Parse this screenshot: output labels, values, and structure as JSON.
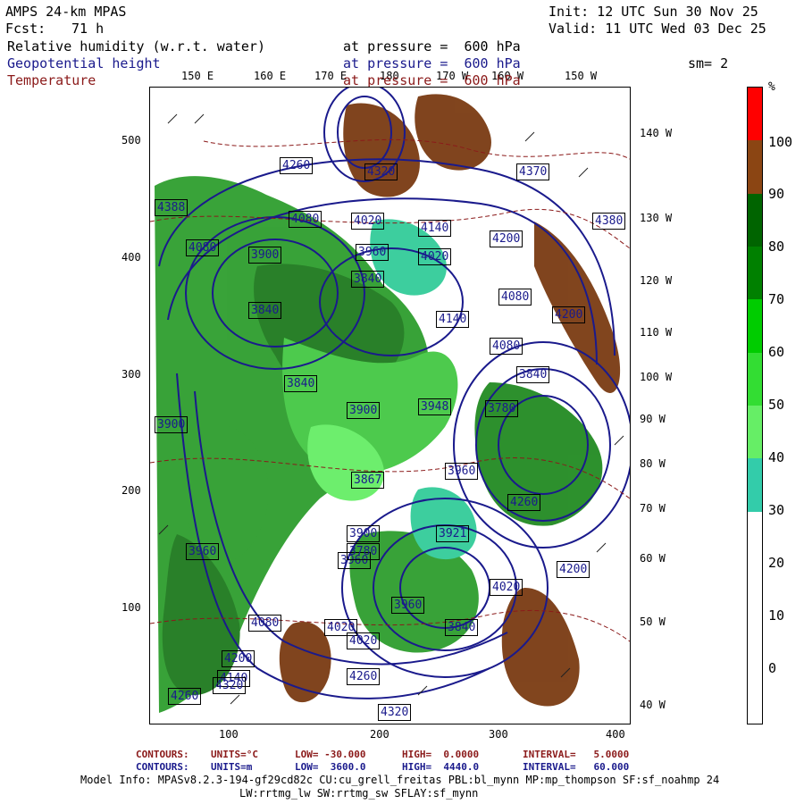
{
  "header": {
    "model": "AMPS 24-km MPAS",
    "init": "Init: 12 UTC Sun 30 Nov 25",
    "fcst_label": "Fcst:",
    "fcst_value": "71 h",
    "valid": "Valid: 11 UTC Wed 03 Dec 25",
    "fields": [
      {
        "name": "Relative humidity (w.r.t. water)",
        "level": "at pressure =  600 hPa",
        "color": "#000000"
      },
      {
        "name": "Geopotential height",
        "level": "at pressure =  600 hPa",
        "color": "#1a1a8c"
      },
      {
        "name": "Temperature",
        "level": "at pressure =  600 hPa",
        "color": "#8b1a1a"
      }
    ],
    "smoothing": "sm= 2"
  },
  "axes": {
    "y_ticks": [
      "500",
      "400",
      "300",
      "200",
      "100"
    ],
    "x_ticks": [
      "100",
      "200",
      "300",
      "400"
    ],
    "top_lon": [
      "150 E",
      "160 E",
      "170 E",
      "180",
      "170 W",
      "160 W",
      "150 W"
    ],
    "right_lon": [
      "140 W",
      "130 W",
      "120 W",
      "110 W",
      "100 W",
      "90 W",
      "80 W",
      "70 W",
      "60 W",
      "50 W",
      "40 W"
    ]
  },
  "height_labels": [
    "4260",
    "4320",
    "4370",
    "4380",
    "4080",
    "4020",
    "3900",
    "4140",
    "4200",
    "4388",
    "4080",
    "3960",
    "4020",
    "4080",
    "3840",
    "3840",
    "4140",
    "4200",
    "4080",
    "3900",
    "3840",
    "3948",
    "3780",
    "3840",
    "4260",
    "3960",
    "3900",
    "3867",
    "3921",
    "3900",
    "3960",
    "4020",
    "4200",
    "3960",
    "3840",
    "4020",
    "4080",
    "4140",
    "4200",
    "4260",
    "4020",
    "4260",
    "4320",
    "4320",
    "3960",
    "3780"
  ],
  "colorbar": {
    "unit": "%",
    "labels": [
      "100",
      "90",
      "80",
      "70",
      "60",
      "50",
      "40",
      "30",
      "20",
      "10",
      "0"
    ],
    "segments": [
      {
        "color": "#ff0000"
      },
      {
        "color": "#8b4513"
      },
      {
        "color": "#006400"
      },
      {
        "color": "#008000"
      },
      {
        "color": "#00cc00"
      },
      {
        "color": "#33dd33"
      },
      {
        "color": "#66ee66"
      },
      {
        "color": "#33ccaa"
      },
      {
        "color": "#ffffff"
      },
      {
        "color": "#ffffff"
      },
      {
        "color": "#ffffff"
      },
      {
        "color": "#ffffff"
      }
    ]
  },
  "footer": {
    "temp_contours": {
      "label": "CONTOURS:",
      "units": "UNITS=°C",
      "low": "LOW= -30.000",
      "high": "HIGH=  0.0000",
      "interval": "INTERVAL=   5.0000",
      "color": "#8b1a1a"
    },
    "hgt_contours": {
      "label": "CONTOURS:",
      "units": "UNITS=m",
      "low": "LOW=  3600.0",
      "high": "HIGH=  4440.0",
      "interval": "INTERVAL=   60.000",
      "color": "#1a1a8c"
    },
    "model_info_1": "Model Info: MPASv8.2.3-194-gf29cd82c CU:cu_grell_freitas PBL:bl_mynn MP:mp_thompson SF:sf_noahmp 24",
    "model_info_2": "LW:rrtmg_lw SW:rrtmg_sw SFLAY:sf_mynn"
  }
}
